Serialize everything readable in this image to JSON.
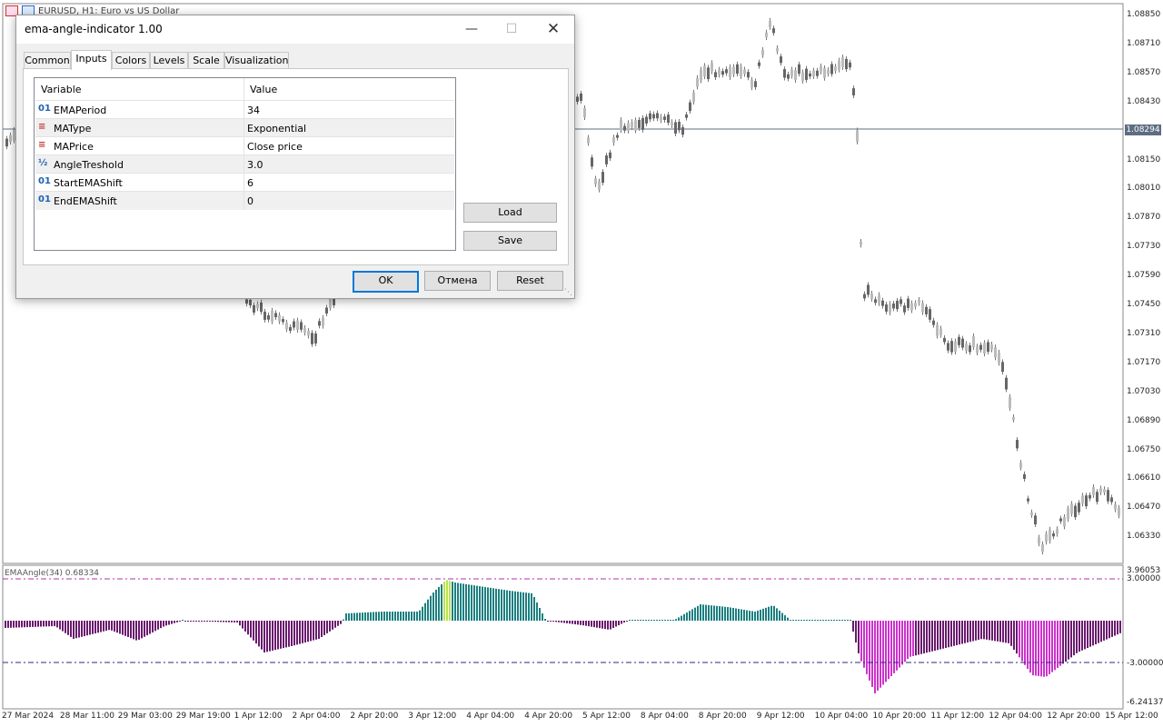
{
  "window": {
    "title": "EURUSD, H1:  Euro vs US Dollar"
  },
  "chart": {
    "current_price": "1.08294",
    "price_labels": [
      "1.08850",
      "1.08710",
      "1.08570",
      "1.08430",
      "1.08294",
      "1.08150",
      "1.08010",
      "1.07870",
      "1.07730",
      "1.07590",
      "1.07450",
      "1.07310",
      "1.07170",
      "1.07030",
      "1.06890",
      "1.06750",
      "1.06610",
      "1.06470",
      "1.06330"
    ],
    "indicator_labels": [
      "3.96053",
      "3.00000",
      "-3.00000",
      "-6.24137"
    ],
    "indicator_title": "EMAAngle(34) 0.68334",
    "time_labels": [
      "27 Mar 2024",
      "28 Mar 11:00",
      "29 Mar 03:00",
      "29 Mar 19:00",
      "1 Apr 12:00",
      "2 Apr 04:00",
      "2 Apr 20:00",
      "3 Apr 12:00",
      "4 Apr 04:00",
      "4 Apr 20:00",
      "5 Apr 12:00",
      "8 Apr 04:00",
      "8 Apr 20:00",
      "9 Apr 12:00",
      "10 Apr 04:00",
      "10 Apr 20:00",
      "11 Apr 12:00",
      "12 Apr 04:00",
      "12 Apr 20:00",
      "15 Apr 12:00"
    ],
    "colors": {
      "up_bar": "#1e7f80",
      "down_bar": "#6a1b6e",
      "strong_up": "#b7e34a",
      "strong_down": "#cc33cc",
      "level_up": "#b030b0",
      "level_down": "#2a2a80",
      "candle": "#888888"
    }
  },
  "dialog": {
    "title": "ema-angle-indicator 1.00",
    "tabs": [
      "Common",
      "Inputs",
      "Colors",
      "Levels",
      "Scale",
      "Visualization"
    ],
    "active_tab": "Inputs",
    "grid_headers": {
      "variable": "Variable",
      "value": "Value"
    },
    "params": [
      {
        "icon": "01",
        "name": "EMAPeriod",
        "value": "34"
      },
      {
        "icon": "≡",
        "name": "MAType",
        "value": "Exponential"
      },
      {
        "icon": "≡",
        "name": "MAPrice",
        "value": "Close price"
      },
      {
        "icon": "½",
        "name": "AngleTreshold",
        "value": "3.0"
      },
      {
        "icon": "01",
        "name": "StartEMAShift",
        "value": "6"
      },
      {
        "icon": "01",
        "name": "EndEMAShift",
        "value": "0"
      }
    ],
    "buttons": {
      "load": "Load",
      "save": "Save",
      "ok": "OK",
      "cancel": "Отмена",
      "reset": "Reset"
    }
  }
}
